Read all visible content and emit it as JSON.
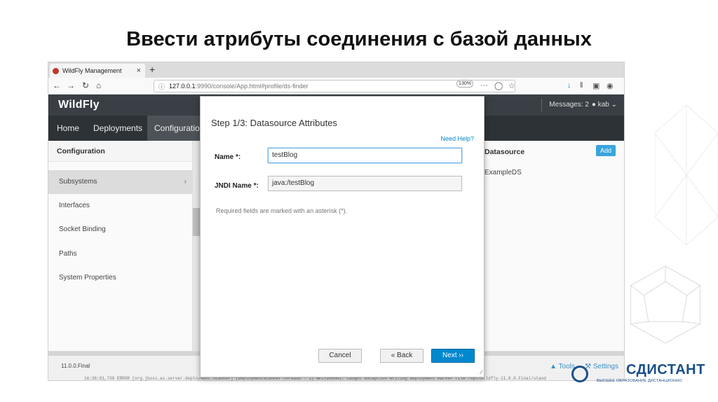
{
  "slide": {
    "title": "Ввести атрибуты соединения с базой данных"
  },
  "browser": {
    "tab_title": "WildFly Management",
    "tab_close": "×",
    "new_tab": "+",
    "url_host": "127.0.0.1",
    "url_path": ":9990/console/App.html#profile/ds-finder",
    "zoom": "130%",
    "more": "···"
  },
  "app": {
    "logo": "WildFly",
    "messages": "Messages: 2",
    "user": "kab",
    "nav": [
      "Home",
      "Deployments",
      "Configuration"
    ],
    "left_col_header": "Configuration",
    "left_items": [
      "Subsystems",
      "Interfaces",
      "Socket Binding",
      "Paths",
      "System Properties"
    ],
    "right_col_header": "Datasource",
    "add_label": "Add",
    "right_item": "ExampleDS",
    "version": "11.0.0.Final",
    "tools": "Tools",
    "settings": "Settings",
    "console_text": "16:38:01,738 ERROR [org.jboss.as.server.deployment.scanner] (DeploymentScanner-threads - 1) WFLYDS0001: Caught exception writing deployment marker file /opt/wildfly-11.0.0.Final/stand"
  },
  "modal": {
    "title": "Step 1/3: Datasource Attributes",
    "help": "Need Help?",
    "name_label": "Name",
    "name_value": "testBlog",
    "jndi_label": "JNDI Name",
    "jndi_value": "java:/testBlog",
    "required_note": "Required fields are marked with an asterisk (*).",
    "cancel": "Cancel",
    "back": "« Back",
    "next": "Next ››"
  },
  "brand": {
    "name": "СДИСТАНТ",
    "tagline": "ВЫСШЕЕ ОБРАЗОВАНИЕ ДИСТАНЦИОННО"
  },
  "colors": {
    "primary": "#0088ce",
    "header": "#393f44",
    "brand": "#1a4f8a"
  }
}
